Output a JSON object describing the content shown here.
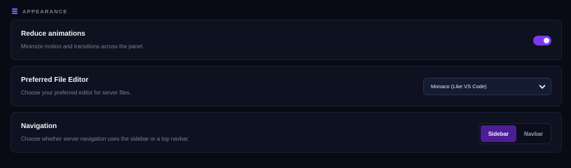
{
  "section": {
    "title": "APPEARANCE",
    "icon": "menu-lines-icon",
    "accent": "#8b5cf6"
  },
  "reduce_animations": {
    "title": "Reduce animations",
    "description": "Minimize motion and transitions across the panel.",
    "enabled": true
  },
  "file_editor": {
    "title": "Preferred File Editor",
    "description": "Choose your preferred editor for server files.",
    "selected": "Monaco (Like VS Code)",
    "icon": "chevron-down-icon"
  },
  "navigation": {
    "title": "Navigation",
    "description": "Choose whether server navigation uses the sidebar or a top navbar.",
    "options": [
      "Sidebar",
      "Navbar"
    ],
    "selected": "Sidebar"
  }
}
